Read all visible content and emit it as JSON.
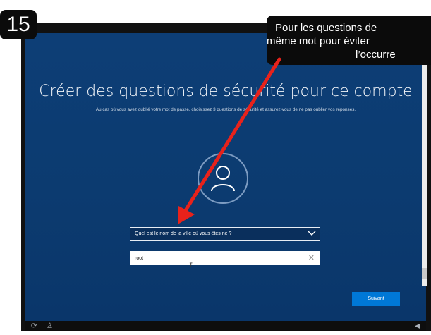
{
  "step": {
    "number": "15"
  },
  "callout": {
    "line1": "Pour les questions de",
    "line2": "même mot pour éviter",
    "line3": "l’occurre"
  },
  "setup": {
    "title": "Créer des questions de sécurité pour ce compte",
    "subtitle": "Au cas où vous avez oublié votre mot de passe, choisissez 3 questions de sécurité et assurez-vous de ne pas oublier vos réponses.",
    "avatar_icon": "user-icon",
    "question": {
      "selected": "Quel est le nom de la ville où vous êtes né ?"
    },
    "answer": {
      "value": "root",
      "clear_icon": "close-icon"
    },
    "next_label": "Suivant"
  },
  "taskbar": {
    "icons": [
      "ease-of-access-icon",
      "microphone-icon",
      "volume-icon"
    ]
  },
  "colors": {
    "background": "#0c3b70",
    "accent": "#0078d7",
    "arrow": "#e8221b"
  }
}
